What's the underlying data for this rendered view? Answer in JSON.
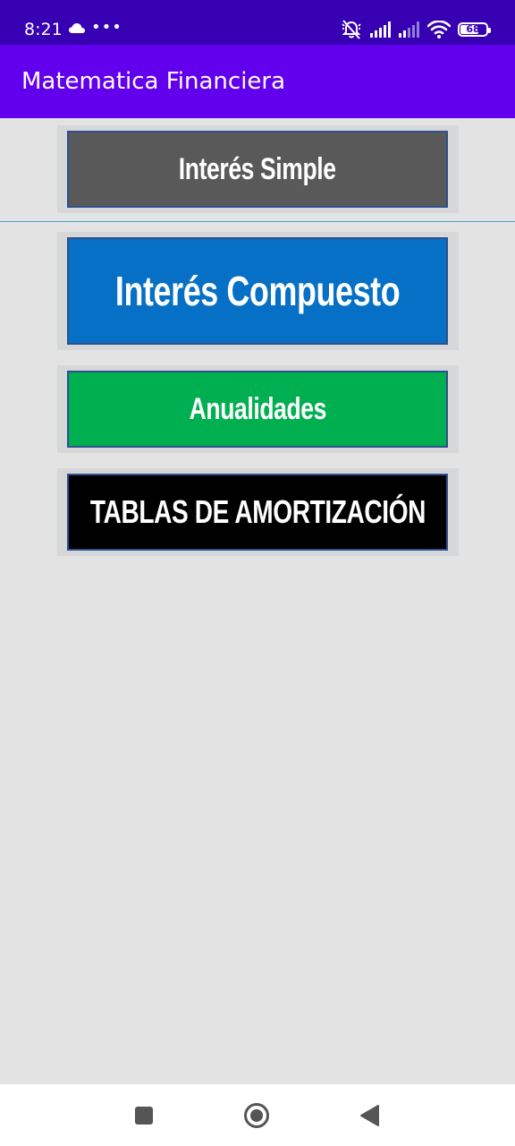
{
  "status_bar": {
    "time": "8:21",
    "dots": "•••",
    "battery_level": "68",
    "icons": [
      "cloud-icon",
      "more-dots-icon",
      "alarm-off-icon",
      "signal-icon",
      "signal-icon-2",
      "wifi-icon",
      "battery-icon"
    ]
  },
  "app_bar": {
    "title": "Matematica Financiera",
    "color": "#6200ee"
  },
  "menu": {
    "items": [
      {
        "label": "Interés Simple",
        "color": "#595959"
      },
      {
        "label": "Interés Compuesto",
        "color": "#0570c5"
      },
      {
        "label": "Anualidades",
        "color": "#00b050"
      },
      {
        "label": "TABLAS DE AMORTIZACIÓN",
        "color": "#000000"
      }
    ]
  },
  "nav_bar": {
    "icons": [
      "recents-square-icon",
      "home-circle-icon",
      "back-triangle-icon"
    ]
  }
}
